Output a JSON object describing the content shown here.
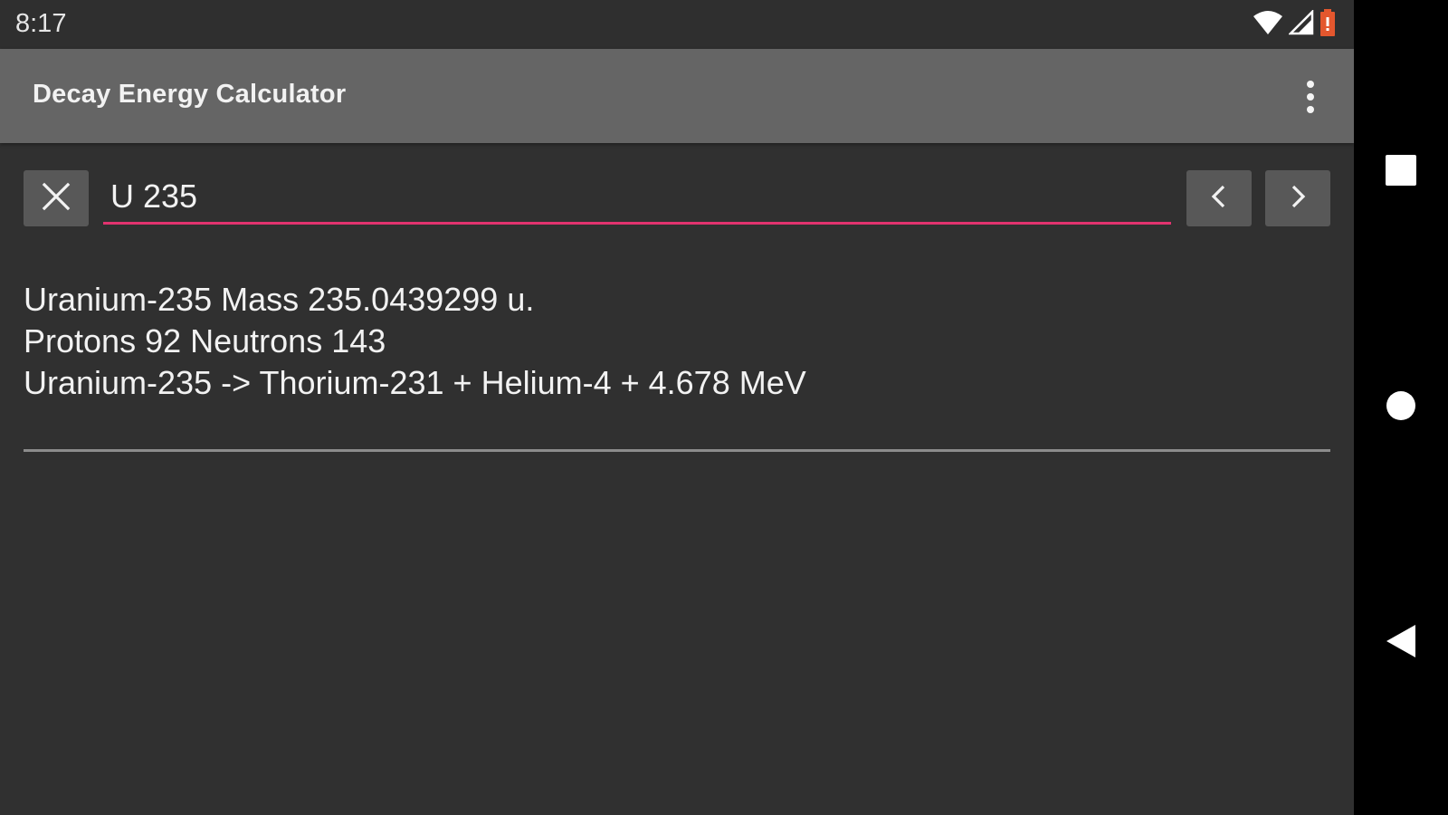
{
  "status_bar": {
    "time": "8:17",
    "icons": [
      "wifi-icon",
      "cellular-signal-icon",
      "battery-low-icon"
    ],
    "battery_color": "#e4572e"
  },
  "app_bar": {
    "title": "Decay Energy Calculator",
    "menu_icon": "more-vert-icon"
  },
  "search": {
    "value": "U 235",
    "clear_icon": "close-icon",
    "prev_icon": "chevron-left-icon",
    "next_icon": "chevron-right-icon",
    "accent_color": "#e2336f"
  },
  "result": {
    "lines": [
      "Uranium-235 Mass 235.0439299 u.",
      "Protons 92 Neutrons 143",
      "Uranium-235 -> Thorium-231 + Helium-4 + 4.678 MeV"
    ]
  },
  "nav_bar": {
    "buttons": [
      "recents-icon",
      "home-icon",
      "back-icon"
    ]
  },
  "colors": {
    "background": "#303030",
    "app_bar": "#656565",
    "button": "#585858",
    "divider": "#8c8c8c"
  }
}
